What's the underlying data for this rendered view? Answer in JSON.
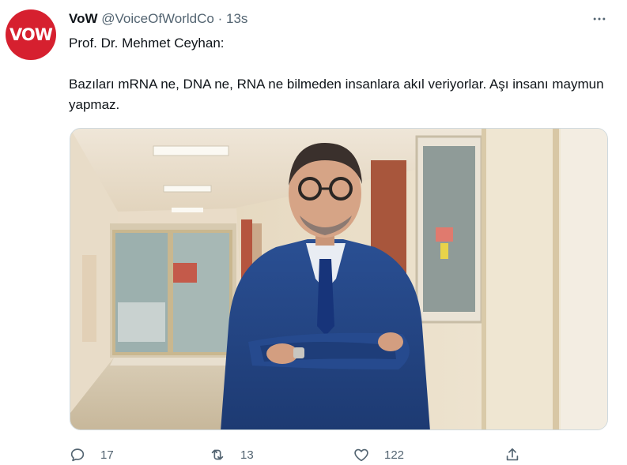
{
  "tweet": {
    "avatar_text": "VOW",
    "author_name": "VoW",
    "handle": "@VoiceOfWorldCo",
    "separator": "·",
    "time": "13s",
    "more_icon": "more-dots-icon",
    "text_line1": "Prof. Dr. Mehmet Ceyhan:",
    "text_line2": "Bazıları mRNA ne, DNA ne, RNA ne bilmeden insanlara akıl veriyorlar. Aşı insanı maymun yapmaz.",
    "media_description": "photo-of-man-in-hospital-corridor"
  },
  "actions": {
    "reply": {
      "icon": "reply-icon",
      "count": "17"
    },
    "retweet": {
      "icon": "retweet-icon",
      "count": "13"
    },
    "like": {
      "icon": "like-icon",
      "count": "122"
    },
    "share": {
      "icon": "share-icon"
    }
  },
  "colors": {
    "avatar_bg": "#d6202f",
    "secondary_text": "#536471",
    "primary_text": "#0f1419"
  }
}
